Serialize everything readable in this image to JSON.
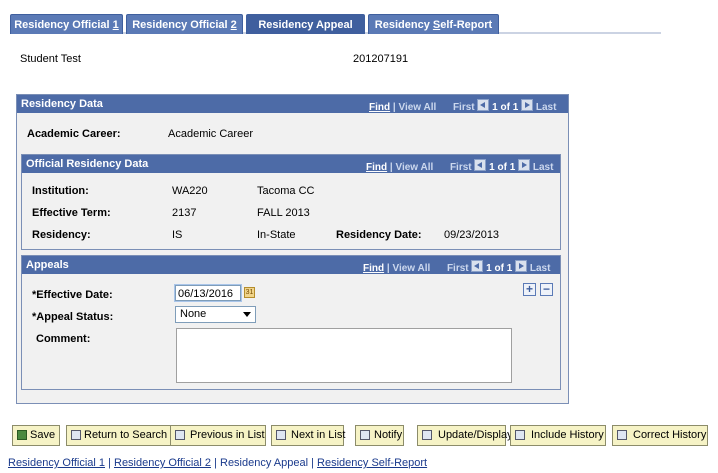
{
  "tabs": [
    {
      "pre": "Residency Official ",
      "key": "1",
      "post": "",
      "active": false
    },
    {
      "pre": "Residency Official ",
      "key": "2",
      "post": "",
      "active": false
    },
    {
      "pre": "Residency Appeal",
      "key": "",
      "post": "",
      "active": true
    },
    {
      "pre": "Residency ",
      "key": "S",
      "post": "elf-Report",
      "active": false
    }
  ],
  "student": {
    "name": "Student Test",
    "id": "201207191"
  },
  "nav": {
    "find": "Find",
    "sep": " | ",
    "view_all": "View All",
    "first": "First",
    "count": "1 of 1",
    "last": "Last"
  },
  "residency_data": {
    "title": "Residency Data",
    "academic_career_label": "Academic Career:",
    "academic_career_value": "Academic Career"
  },
  "official": {
    "title": "Official Residency Data",
    "institution_label": "Institution:",
    "institution_code": "WA220",
    "institution_name": "Tacoma CC",
    "term_label": "Effective Term:",
    "term_code": "2137",
    "term_name": "FALL 2013",
    "residency_label": "Residency:",
    "residency_code": "IS",
    "residency_name": "In-State",
    "residency_date_label": "Residency Date:",
    "residency_date": "09/23/2013"
  },
  "appeals": {
    "title": "Appeals",
    "effective_date_label": "*Effective Date:",
    "effective_date": "06/13/2016",
    "appeal_status_label": "*Appeal Status:",
    "appeal_status": "None",
    "comment_label": "Comment:",
    "comment": ""
  },
  "toolbar": {
    "save": "Save",
    "return_to_search": "Return to Search",
    "previous_in_list": "Previous in List",
    "next_in_list": "Next in List",
    "notify": "Notify",
    "update_display": "Update/Display",
    "include_history": "Include History",
    "correct_history": "Correct History"
  },
  "footer": {
    "official1": "Residency Official 1",
    "official2": "Residency Official 2",
    "appeal": "Residency Appeal",
    "self_report": "Residency Self-Report",
    "sep": " | "
  }
}
